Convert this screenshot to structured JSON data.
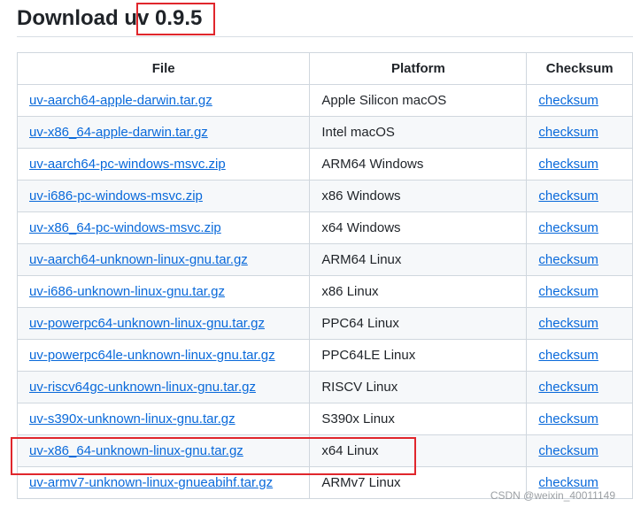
{
  "release": {
    "heading": "Download uv 0.9.5"
  },
  "table": {
    "headers": {
      "file": "File",
      "platform": "Platform",
      "checksum": "Checksum"
    },
    "rows": [
      {
        "file": "uv-aarch64-apple-darwin.tar.gz",
        "platform": "Apple Silicon macOS",
        "checksum": "checksum"
      },
      {
        "file": "uv-x86_64-apple-darwin.tar.gz",
        "platform": "Intel macOS",
        "checksum": "checksum"
      },
      {
        "file": "uv-aarch64-pc-windows-msvc.zip",
        "platform": "ARM64 Windows",
        "checksum": "checksum"
      },
      {
        "file": "uv-i686-pc-windows-msvc.zip",
        "platform": "x86 Windows",
        "checksum": "checksum"
      },
      {
        "file": "uv-x86_64-pc-windows-msvc.zip",
        "platform": "x64 Windows",
        "checksum": "checksum"
      },
      {
        "file": "uv-aarch64-unknown-linux-gnu.tar.gz",
        "platform": "ARM64 Linux",
        "checksum": "checksum"
      },
      {
        "file": "uv-i686-unknown-linux-gnu.tar.gz",
        "platform": "x86 Linux",
        "checksum": "checksum"
      },
      {
        "file": "uv-powerpc64-unknown-linux-gnu.tar.gz",
        "platform": "PPC64 Linux",
        "checksum": "checksum"
      },
      {
        "file": "uv-powerpc64le-unknown-linux-gnu.tar.gz",
        "platform": "PPC64LE Linux",
        "checksum": "checksum"
      },
      {
        "file": "uv-riscv64gc-unknown-linux-gnu.tar.gz",
        "platform": "RISCV Linux",
        "checksum": "checksum"
      },
      {
        "file": "uv-s390x-unknown-linux-gnu.tar.gz",
        "platform": "S390x Linux",
        "checksum": "checksum"
      },
      {
        "file": "uv-x86_64-unknown-linux-gnu.tar.gz",
        "platform": "x64 Linux",
        "checksum": "checksum"
      },
      {
        "file": "uv-armv7-unknown-linux-gnueabihf.tar.gz",
        "platform": "ARMv7 Linux",
        "checksum": "checksum"
      }
    ]
  },
  "watermark": "CSDN @weixin_40011149",
  "colors": {
    "link": "#0969da",
    "highlight": "#e0262c",
    "border": "#d0d7de",
    "stripe": "#f6f8fa"
  }
}
